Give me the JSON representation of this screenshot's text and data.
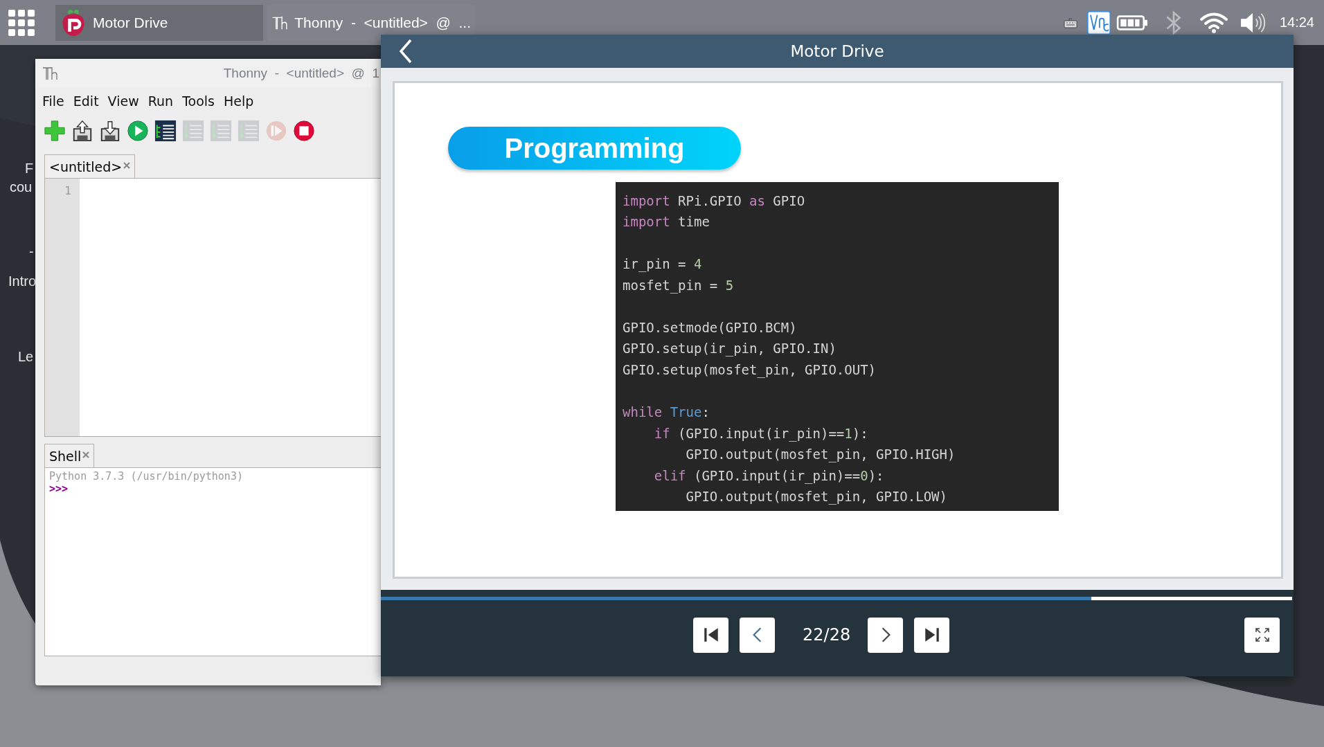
{
  "taskbar": {
    "tasks": [
      {
        "label": "Motor Drive",
        "selected": true,
        "kind": "raspberry"
      },
      {
        "label": "Thonny  -  <untitled>  @  ...",
        "selected": false,
        "kind": "thonny"
      }
    ],
    "clock": "14:24"
  },
  "background_text": [
    "F",
    "cou",
    "-",
    "Intro",
    "Le"
  ],
  "thonny": {
    "title": "Thonny  -  <untitled>  @  1",
    "menu": [
      "File",
      "Edit",
      "View",
      "Run",
      "Tools",
      "Help"
    ],
    "toolbar": [
      {
        "kind": "new",
        "disabled": false
      },
      {
        "kind": "load",
        "disabled": false
      },
      {
        "kind": "save",
        "disabled": false
      },
      {
        "kind": "run",
        "disabled": false
      },
      {
        "kind": "debug",
        "disabled": false
      },
      {
        "kind": "step_over",
        "disabled": true
      },
      {
        "kind": "step_into",
        "disabled": true
      },
      {
        "kind": "step_out",
        "disabled": true
      },
      {
        "kind": "resume",
        "disabled": true
      },
      {
        "kind": "stop",
        "disabled": false
      }
    ],
    "editor_tab": "<untitled>",
    "line_numbers": [
      "1"
    ],
    "shell": {
      "tab": "Shell",
      "banner": "Python 3.7.3 (/usr/bin/python3)",
      "prompt": ">>>"
    }
  },
  "viewer": {
    "title": "Motor Drive",
    "heading": "Programming",
    "code_blocks": [
      {
        "lines": [
          [
            {
              "kind": "keyword",
              "text": "import"
            },
            {
              "kind": "plain",
              "text": " RPi.GPIO "
            },
            {
              "kind": "keyword",
              "text": "as"
            },
            {
              "kind": "plain",
              "text": " GPIO"
            }
          ],
          [
            {
              "kind": "keyword",
              "text": "import"
            },
            {
              "kind": "plain",
              "text": " time"
            }
          ]
        ]
      },
      {
        "lines": [
          [
            {
              "kind": "plain",
              "text": "ir_pin = "
            },
            {
              "kind": "number",
              "text": "4"
            }
          ],
          [
            {
              "kind": "plain",
              "text": "mosfet_pin = "
            },
            {
              "kind": "number",
              "text": "5"
            }
          ]
        ]
      },
      {
        "lines": [
          [
            {
              "kind": "plain",
              "text": "GPIO.setmode(GPIO.BCM)"
            }
          ],
          [
            {
              "kind": "plain",
              "text": "GPIO.setup(ir_pin, GPIO.IN)"
            }
          ],
          [
            {
              "kind": "plain",
              "text": "GPIO.setup(mosfet_pin, GPIO.OUT)"
            }
          ]
        ]
      },
      {
        "lines": [
          [
            {
              "kind": "keyword",
              "text": "while"
            },
            {
              "kind": "constant",
              "text": " True"
            },
            {
              "kind": "plain",
              "text": ":"
            }
          ],
          [
            {
              "kind": "keyword",
              "text": "    if"
            },
            {
              "kind": "plain",
              "text": " (GPIO.input(ir_pin)=="
            },
            {
              "kind": "number",
              "text": "1"
            },
            {
              "kind": "plain",
              "text": "):"
            }
          ],
          [
            {
              "kind": "plain",
              "text": "        GPIO.output(mosfet_pin, GPIO.HIGH)"
            }
          ],
          [
            {
              "kind": "keyword",
              "text": "    elif"
            },
            {
              "kind": "plain",
              "text": " (GPIO.input(ir_pin)=="
            },
            {
              "kind": "number",
              "text": "0"
            },
            {
              "kind": "plain",
              "text": "):"
            }
          ],
          [
            {
              "kind": "plain",
              "text": "        GPIO.output(mosfet_pin, GPIO.LOW)"
            }
          ]
        ]
      }
    ],
    "progress": {
      "level": 0.78
    },
    "page": "22/28"
  }
}
